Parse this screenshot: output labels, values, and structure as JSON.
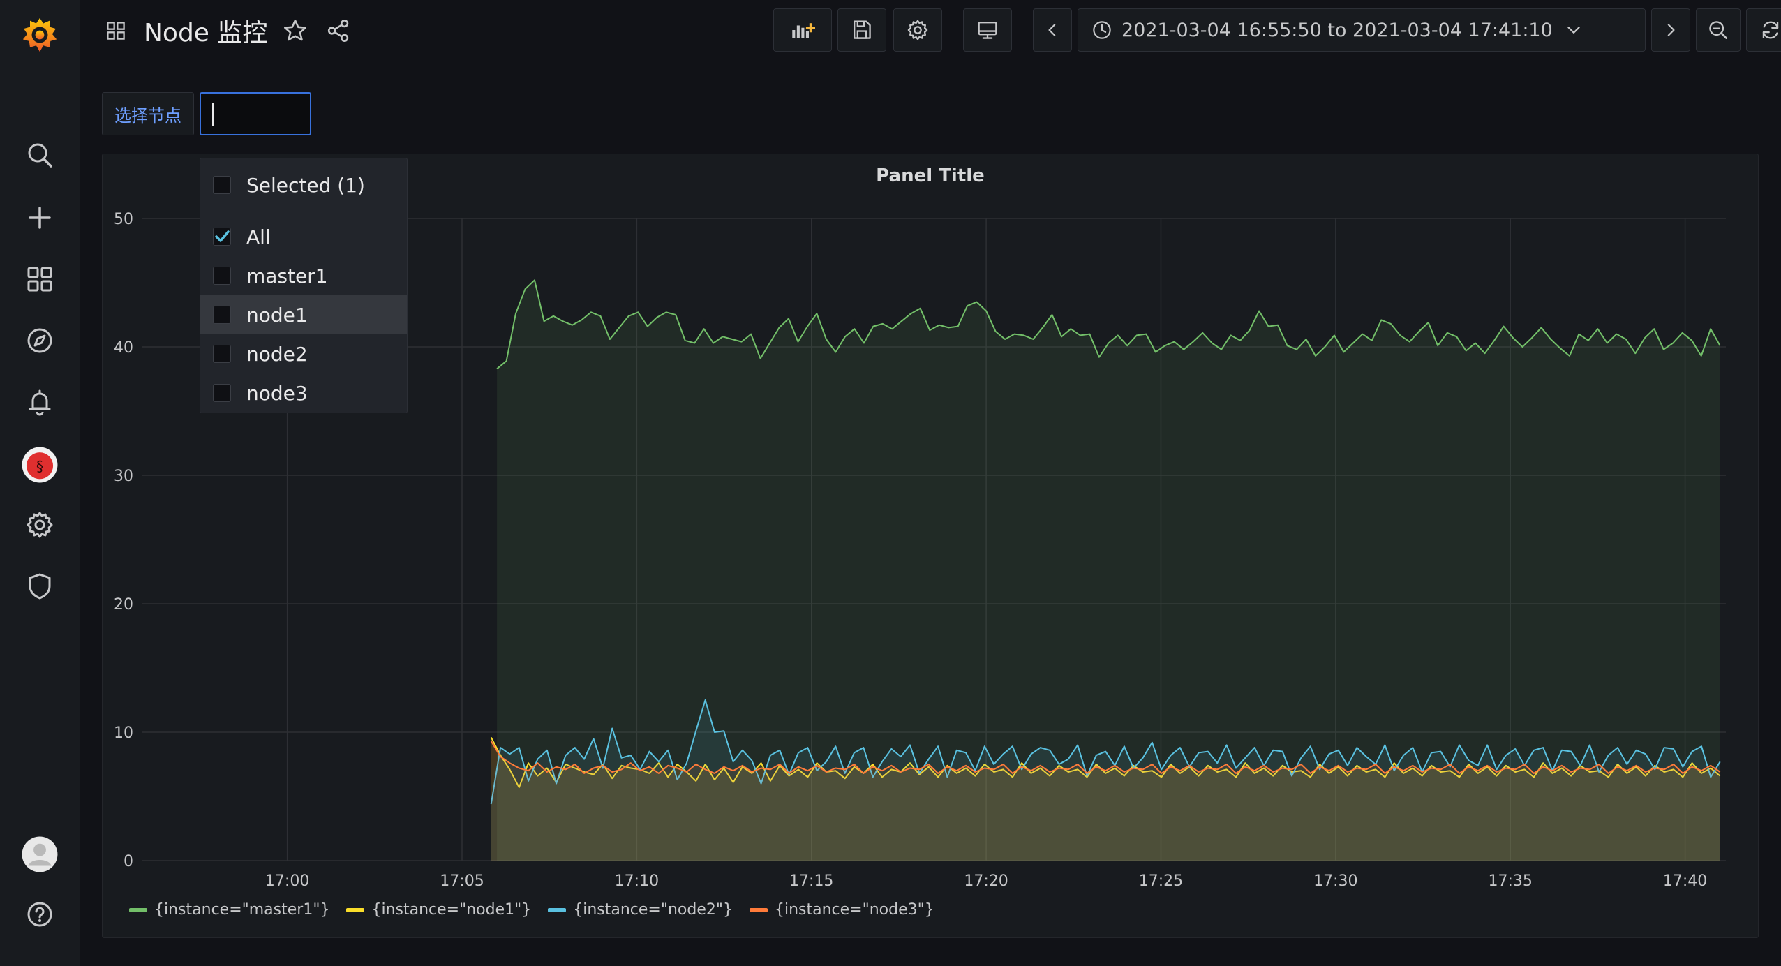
{
  "app": {
    "dashboard_title": "Node 监控",
    "time_range": "2021-03-04 16:55:50 to 2021-03-04 17:41:10"
  },
  "sidebar": {
    "items": [
      "grafana-logo-icon",
      "search-icon",
      "plus-icon",
      "dashboards-icon",
      "compass-icon",
      "bell-icon",
      "avatar-plugin-icon",
      "gear-icon",
      "shield-icon",
      "user-avatar-icon",
      "help-icon"
    ]
  },
  "toolbar": {
    "icons": [
      "add-panel-icon",
      "save-icon",
      "settings-icon",
      "tv-mode-icon",
      "chevron-left-icon",
      "clock-icon",
      "chevron-down-icon",
      "chevron-right-icon",
      "zoom-out-icon",
      "refresh-icon",
      "chevron-down-icon"
    ]
  },
  "variable": {
    "label": "选择节点",
    "input_value": ""
  },
  "dropdown": {
    "header": "Selected (1)",
    "options": [
      {
        "label": "All",
        "checked": true
      },
      {
        "label": "master1",
        "checked": false
      },
      {
        "label": "node1",
        "checked": false,
        "hover": true
      },
      {
        "label": "node2",
        "checked": false
      },
      {
        "label": "node3",
        "checked": false
      }
    ]
  },
  "panel": {
    "title": "Panel Title"
  },
  "chart_data": {
    "type": "area",
    "title": "Panel Title",
    "x_ticks": [
      "17:00",
      "17:05",
      "17:10",
      "17:15",
      "17:20",
      "17:25",
      "17:30",
      "17:35",
      "17:40"
    ],
    "x_start": "16:55:50",
    "x_end": "17:41:10",
    "y_ticks": [
      "0",
      "10",
      "20",
      "30",
      "40",
      "50"
    ],
    "ylim": [
      0,
      50
    ],
    "grid": true,
    "legend_position": "bottom-left",
    "series": [
      {
        "name": "{instance=\"master1\"}",
        "color": "#73bf69",
        "start": "17:06",
        "values": [
          38.3,
          38.9,
          42.6,
          44.5,
          45.2,
          42,
          42.4,
          42,
          41.7,
          42.1,
          42.7,
          42.4,
          40.6,
          41.5,
          42.4,
          42.7,
          41.6,
          42.3,
          42.7,
          42.5,
          40.5,
          40.3,
          41.4,
          40.3,
          40.8,
          40.6,
          40.4,
          41,
          39.1,
          40.3,
          41.5,
          42.2,
          40.4,
          41.6,
          42.6,
          40.6,
          39.6,
          40.8,
          41.4,
          40.3,
          41.6,
          41.8,
          41.4,
          42,
          42.6,
          43,
          41.3,
          41.7,
          41.5,
          41.6,
          43.2,
          43.5,
          42.8,
          41.2,
          40.6,
          41,
          40.9,
          40.6,
          41.5,
          42.5,
          40.8,
          41.4,
          40.9,
          41,
          39.2,
          40.3,
          40.9,
          40.1,
          40.9,
          41,
          39.6,
          40.1,
          40.4,
          39.8,
          40.4,
          41.1,
          40.3,
          39.8,
          40.9,
          40.5,
          41.3,
          42.8,
          41.6,
          41.7,
          40.1,
          39.8,
          40.6,
          39.3,
          40,
          40.9,
          39.6,
          40.3,
          41,
          40.5,
          42.1,
          41.8,
          40.9,
          40.4,
          41.2,
          41.9,
          40.1,
          41.1,
          40.8,
          39.7,
          40.3,
          39.5,
          40.5,
          41.6,
          40.7,
          40,
          40.7,
          41.5,
          40.6,
          39.9,
          39.3,
          41,
          40.5,
          41.4,
          40.3,
          41,
          40.6,
          39.5,
          40.7,
          41.4,
          39.8,
          40.3,
          41.1,
          40.5,
          39.3,
          41.4,
          40.1
        ]
      },
      {
        "name": "{instance=\"node1\"}",
        "color": "#fade2a",
        "start": "17:05:50",
        "values": [
          9.6,
          8.2,
          7.1,
          5.7,
          7.6,
          6.6,
          7.2,
          6.1,
          7.5,
          7.2,
          6.9,
          6.7,
          7.5,
          6.4,
          7.4,
          7.2,
          7.1,
          6.8,
          7.6,
          6.5,
          7.5,
          6.9,
          6.2,
          7.5,
          6.3,
          7.2,
          6.1,
          7.3,
          6.8,
          7.6,
          6.2,
          7.4,
          6.6,
          7.1,
          6.5,
          7.6,
          6.9,
          7,
          6.4,
          7.3,
          6.8,
          7.5,
          6.5,
          7.1,
          6.9,
          7.6,
          6.7,
          7.3,
          6.5,
          7.4,
          6.8,
          7.2,
          6.6,
          7.5,
          6.9,
          7.1,
          6.5,
          7.6,
          6.8,
          7.2,
          6.6,
          7.4,
          6.9,
          7.1,
          6.5,
          7.5,
          6.8,
          7.2,
          6.6,
          7.4,
          6.9,
          7,
          6.5,
          7.5,
          6.8,
          7.3,
          6.6,
          7.4,
          6.9,
          7.1,
          6.5,
          7.6,
          6.8,
          7.2,
          6.6,
          7.4,
          6.9,
          7,
          6.5,
          7.5,
          6.8,
          7.3,
          6.6,
          7.4,
          6.9,
          7.1,
          6.5,
          7.6,
          6.8,
          7.2,
          6.6,
          7.4,
          6.9,
          7,
          6.5,
          7.5,
          6.8,
          7.3,
          6.6,
          7.4,
          6.9,
          7.1,
          6.5,
          7.6,
          6.8,
          7.2,
          6.6,
          7.4,
          6.9,
          7,
          6.5,
          7.5,
          6.8,
          7.3,
          6.6,
          7.4,
          6.9,
          7.1,
          6.5,
          7.6,
          6.8,
          7.2,
          6.6
        ]
      },
      {
        "name": "{instance=\"node2\"}",
        "color": "#5ac1e0",
        "start": "17:05:50",
        "values": [
          4.4,
          8.8,
          8.3,
          8.8,
          6.2,
          7.9,
          8.6,
          6,
          8.2,
          8.8,
          7.9,
          9.5,
          7.2,
          10.3,
          8,
          8.2,
          7.1,
          8.5,
          7.7,
          8.6,
          6.3,
          7.6,
          10.1,
          12.5,
          10,
          10.1,
          7.7,
          8.6,
          7.8,
          6,
          8.2,
          8.6,
          6.7,
          8.4,
          8.8,
          7,
          7.7,
          8.9,
          6.8,
          8.4,
          8.8,
          6.5,
          7.7,
          8.7,
          8.1,
          9,
          6.8,
          7.9,
          8.9,
          6.5,
          8.6,
          8.4,
          7,
          8.9,
          7.5,
          8.3,
          8.9,
          7.1,
          8.3,
          8.8,
          8.6,
          7.5,
          7.9,
          9,
          6.6,
          8.2,
          8.5,
          7.4,
          8.9,
          7.2,
          8,
          9.2,
          7.1,
          8.2,
          8.8,
          7.3,
          8.4,
          8.5,
          7.6,
          9,
          7.2,
          8,
          8.8,
          7.4,
          8.6,
          8.5,
          6.6,
          8,
          8.9,
          7.1,
          8.3,
          8.6,
          7.4,
          8.8,
          8.1,
          7.5,
          9,
          7,
          8.2,
          8.8,
          6.9,
          8.4,
          8.5,
          7.3,
          9,
          7.8,
          7.4,
          9,
          7.1,
          8.2,
          8.7,
          7.4,
          8.6,
          8.8,
          7,
          8.6,
          8.5,
          7.4,
          9,
          6.9,
          8.2,
          8.8,
          7.5,
          8.6,
          8.3,
          7.1,
          8.8,
          8.7,
          7.3,
          8.5,
          8.9,
          6.5,
          7.7
        ]
      },
      {
        "name": "{instance=\"node3\"}",
        "color": "#ff7b3a",
        "start": "17:05:50",
        "values": [
          9.3,
          8.1,
          7.6,
          7.2,
          7,
          7.6,
          6.9,
          7.3,
          7.1,
          7.5,
          6.8,
          7.2,
          7.4,
          6.9,
          7.1,
          7.6,
          7,
          7.3,
          6.8,
          7.4,
          7.2,
          6.9,
          7.5,
          7.1,
          6.8,
          7.3,
          7,
          7.4,
          6.9,
          7.2,
          7.1,
          7.5,
          6.8,
          7.3,
          7,
          7.4,
          6.9,
          7.2,
          7.1,
          7.5,
          6.8,
          7.3,
          7,
          7.4,
          6.9,
          7.2,
          7.1,
          7.5,
          6.8,
          7.3,
          7,
          7.4,
          6.9,
          7.2,
          7.1,
          7.5,
          6.8,
          7.3,
          7,
          7.4,
          6.9,
          7.2,
          7.1,
          7.5,
          6.8,
          7.3,
          7,
          7.4,
          6.9,
          7.2,
          7.1,
          7.5,
          6.8,
          7.3,
          7,
          7.4,
          6.9,
          7.2,
          7.1,
          7.5,
          6.8,
          7.3,
          7,
          7.4,
          6.9,
          7.2,
          7.1,
          7.5,
          6.8,
          7.3,
          7,
          7.4,
          6.9,
          7.2,
          7.1,
          7.5,
          6.8,
          7.3,
          7,
          7.4,
          6.9,
          7.2,
          7.1,
          7.5,
          6.8,
          7.3,
          7,
          7.4,
          6.9,
          7.2,
          7.1,
          7.5,
          6.8,
          7.3,
          7,
          7.4,
          6.9,
          7.2,
          7.1,
          7.5,
          6.8,
          7.3,
          7,
          7.4,
          6.9,
          7.2,
          7.1,
          7.5,
          6.8,
          7.3,
          7,
          7.4,
          6.9
        ]
      }
    ]
  }
}
